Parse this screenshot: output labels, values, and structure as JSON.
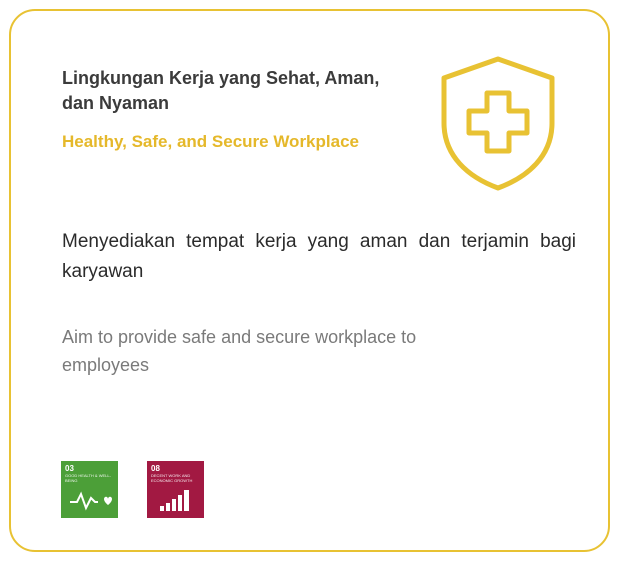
{
  "card": {
    "title_id": "Lingkungan Kerja yang Sehat, Aman, dan Nyaman",
    "title_en": "Healthy, Safe, and Secure Workplace",
    "description_id": "Menyediakan tempat kerja yang aman dan terjamin bagi karyawan",
    "description_en": "Aim to provide safe and secure workplace to employees",
    "icon": "shield-plus-icon",
    "accent_color": "#E8C233"
  },
  "sdg_badges": [
    {
      "number": "03",
      "label": "Good Health & Well-Being",
      "color": "#4C9F38",
      "icon": "heartbeat-icon"
    },
    {
      "number": "08",
      "label": "Decent Work and Economic Growth",
      "color": "#A21942",
      "icon": "growth-bars-icon"
    }
  ]
}
